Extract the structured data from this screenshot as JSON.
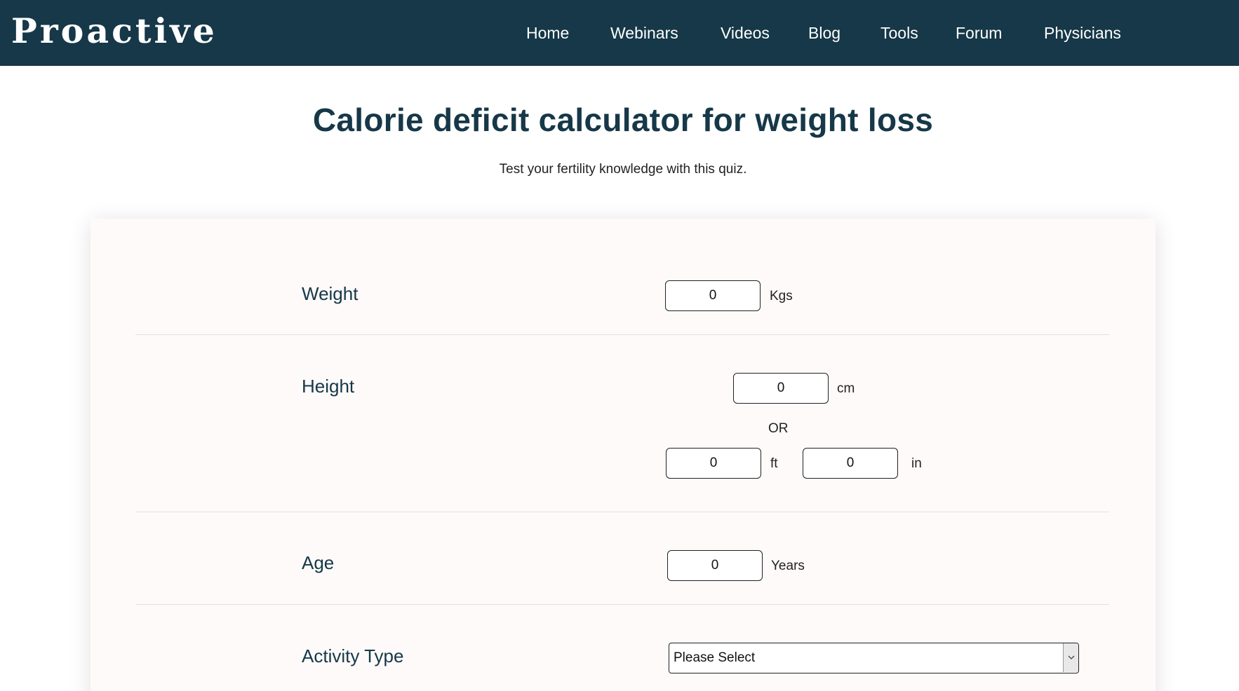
{
  "header": {
    "logo": "Proactive",
    "nav": [
      "Home",
      "Webinars",
      "Videos",
      "Blog",
      "Tools",
      "Forum",
      "Physicians"
    ]
  },
  "page": {
    "title": "Calorie deficit calculator for weight loss",
    "subtitle": "Test your fertility knowledge with this quiz."
  },
  "form": {
    "weight": {
      "label": "Weight",
      "value": "0",
      "unit": "Kgs"
    },
    "height": {
      "label": "Height",
      "cm_value": "0",
      "cm_unit": "cm",
      "or_text": "OR",
      "ft_value": "0",
      "ft_unit": "ft",
      "in_value": "0",
      "in_unit": "in"
    },
    "age": {
      "label": "Age",
      "value": "0",
      "unit": "Years"
    },
    "activity": {
      "label": "Activity Type",
      "selected": "Please Select"
    }
  },
  "colors": {
    "header_bg": "#163848",
    "card_bg": "#fdfaf9",
    "heading": "#163848"
  },
  "icons": {
    "select_arrow": "chevron-down-icon"
  }
}
